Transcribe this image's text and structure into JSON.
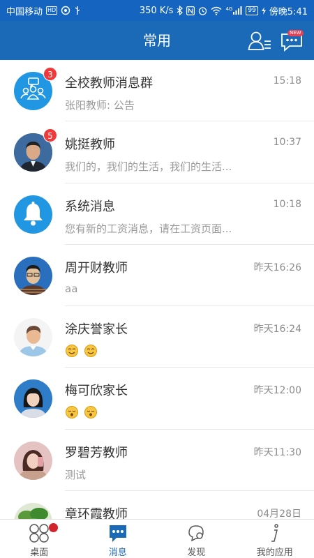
{
  "status_bar": {
    "carrier": "中国移动",
    "hd_badge": "HD",
    "speed": "350 K/s",
    "network": "4G",
    "battery": "99",
    "time": "傍晚5:41"
  },
  "header": {
    "title": "常用",
    "new_tag": "NEW"
  },
  "conversations": [
    {
      "name": "全校教师消息群",
      "time": "15:18",
      "preview": "张阳教师: 公告",
      "unread": "3",
      "avatar": "group-icon"
    },
    {
      "name": "姚挺教师",
      "time": "10:37",
      "preview": "我们的，我们的生活，我们的生活...",
      "unread": "5",
      "avatar": "photo"
    },
    {
      "name": "系统消息",
      "time": "10:18",
      "preview": "您有新的工资消息，请在工资页面...",
      "unread": "",
      "avatar": "bell-icon"
    },
    {
      "name": "周开财教师",
      "time": "昨天16:26",
      "preview": "aa",
      "unread": "",
      "avatar": "photo"
    },
    {
      "name": "涂庆誉家长",
      "time": "昨天16:24",
      "preview": "",
      "unread": "",
      "avatar": "photo",
      "emoji_count": 2
    },
    {
      "name": "梅可欣家长",
      "time": "昨天12:00",
      "preview": "",
      "unread": "",
      "avatar": "photo",
      "emoji_count": 2
    },
    {
      "name": "罗碧芳教师",
      "time": "昨天11:30",
      "preview": "测试",
      "unread": "",
      "avatar": "photo"
    },
    {
      "name": "章环霞教师",
      "time": "04月28日",
      "preview": "",
      "unread": "",
      "avatar": "photo"
    }
  ],
  "tabs": [
    {
      "label": "桌面",
      "icon": "desktop-icon",
      "active": false
    },
    {
      "label": "消息",
      "icon": "message-icon",
      "active": true
    },
    {
      "label": "发现",
      "icon": "discover-icon",
      "active": false
    },
    {
      "label": "我的应用",
      "icon": "my-apps-icon",
      "active": false
    }
  ],
  "colors": {
    "primary": "#1a6ab8",
    "badge": "#f03a3a",
    "app_icon_blue": "#2196e3"
  }
}
